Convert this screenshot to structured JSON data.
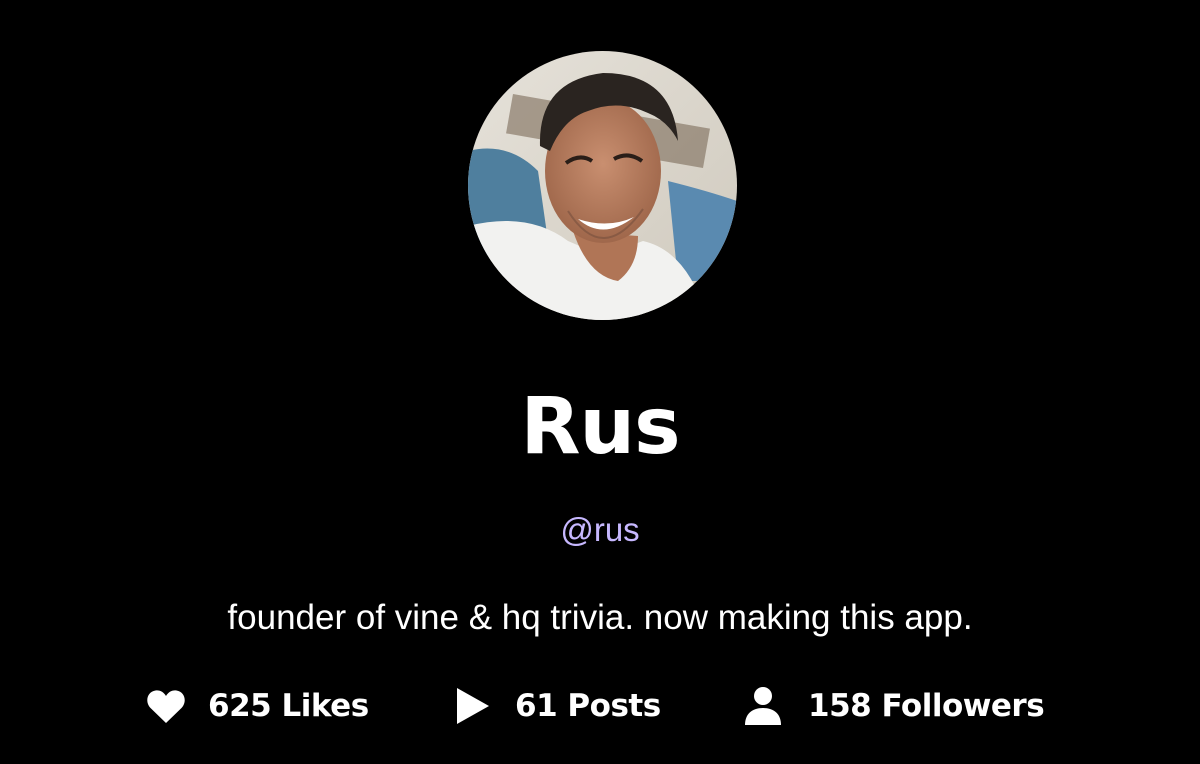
{
  "colors": {
    "background": "#000000",
    "text": "#ffffff",
    "handle_accent": "#c7b8ff"
  },
  "profile": {
    "avatar_alt": "profile photo",
    "name": "Rus",
    "handle": "@rus",
    "bio": "founder of vine & hq trivia. now making this app."
  },
  "stats": {
    "likes": {
      "icon": "heart-icon",
      "label": "625 Likes"
    },
    "posts": {
      "icon": "play-icon",
      "label": "61 Posts"
    },
    "followers": {
      "icon": "person-icon",
      "label": "158 Followers"
    }
  }
}
